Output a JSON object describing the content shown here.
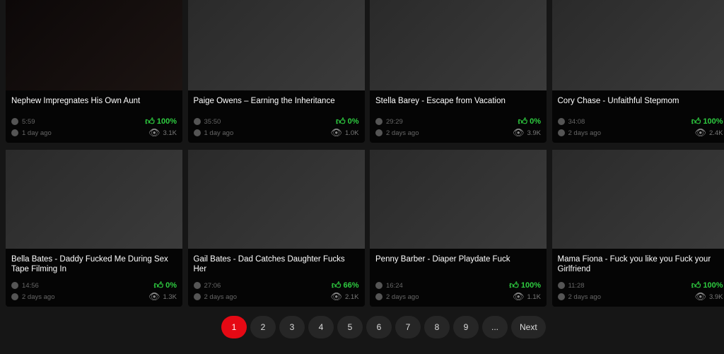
{
  "videos": [
    {
      "title": "Nephew Impregnates His Own Aunt",
      "duration": "5:59",
      "rating": "100%",
      "age": "1 day ago",
      "views": "3.1K"
    },
    {
      "title": "Paige Owens – Earning the Inheritance",
      "duration": "35:50",
      "rating": "0%",
      "age": "1 day ago",
      "views": "1.0K"
    },
    {
      "title": "Stella Barey - Escape from Vacation",
      "duration": "29:29",
      "rating": "0%",
      "age": "2 days ago",
      "views": "3.9K"
    },
    {
      "title": "Cory Chase - Unfaithful Stepmom",
      "duration": "34:08",
      "rating": "100%",
      "age": "2 days ago",
      "views": "2.4K"
    },
    {
      "title": "Bella Bates - Daddy Fucked Me During Sex Tape Filming In",
      "duration": "14:56",
      "rating": "0%",
      "age": "2 days ago",
      "views": "1.3K"
    },
    {
      "title": "Gail Bates - Dad Catches Daughter Fucks Her",
      "duration": "27:06",
      "rating": "66%",
      "age": "2 days ago",
      "views": "2.1K"
    },
    {
      "title": "Penny Barber - Diaper Playdate Fuck",
      "duration": "16:24",
      "rating": "100%",
      "age": "2 days ago",
      "views": "1.1K"
    },
    {
      "title": "Mama Fiona - Fuck you like you Fuck your Girlfriend",
      "duration": "11:28",
      "rating": "100%",
      "age": "2 days ago",
      "views": "3.9K"
    }
  ],
  "pagination": {
    "pages": [
      "1",
      "2",
      "3",
      "4",
      "5",
      "6",
      "7",
      "8",
      "9",
      "..."
    ],
    "current": "1",
    "next_label": "Next"
  },
  "colors": {
    "accent": "#e50914",
    "rating": "#2ecc40"
  },
  "icons": {
    "duration": "clock-icon",
    "age": "calendar-icon",
    "rating": "thumbs-up-icon",
    "views": "eye-icon"
  }
}
